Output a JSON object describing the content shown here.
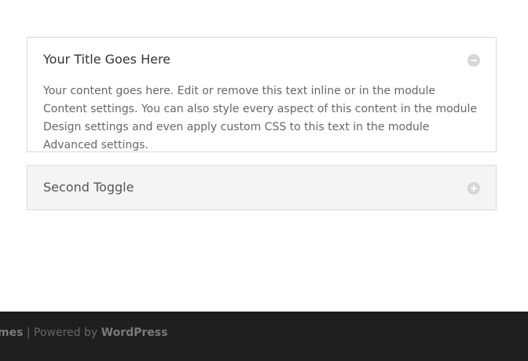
{
  "toggles": [
    {
      "title": "Your Title Goes Here",
      "state": "open",
      "icon": "minus-circle-icon",
      "content": "Your content goes here. Edit or remove this text inline or in the module Content settings. You can also style every aspect of this content in the module Design settings and even apply custom CSS to this text in the module Advanced settings."
    },
    {
      "title": "Second Toggle",
      "state": "closed",
      "icon": "plus-circle-icon"
    }
  ],
  "footer": {
    "credits_prefix": "mes",
    "separator": " | Powered by ",
    "powered_by_link": "WordPress"
  },
  "colors": {
    "footer_background": "#1f1f1f",
    "closed_toggle_background": "#f4f4f4",
    "border": "#d9d9d9",
    "icon": "#d6d6d6"
  }
}
